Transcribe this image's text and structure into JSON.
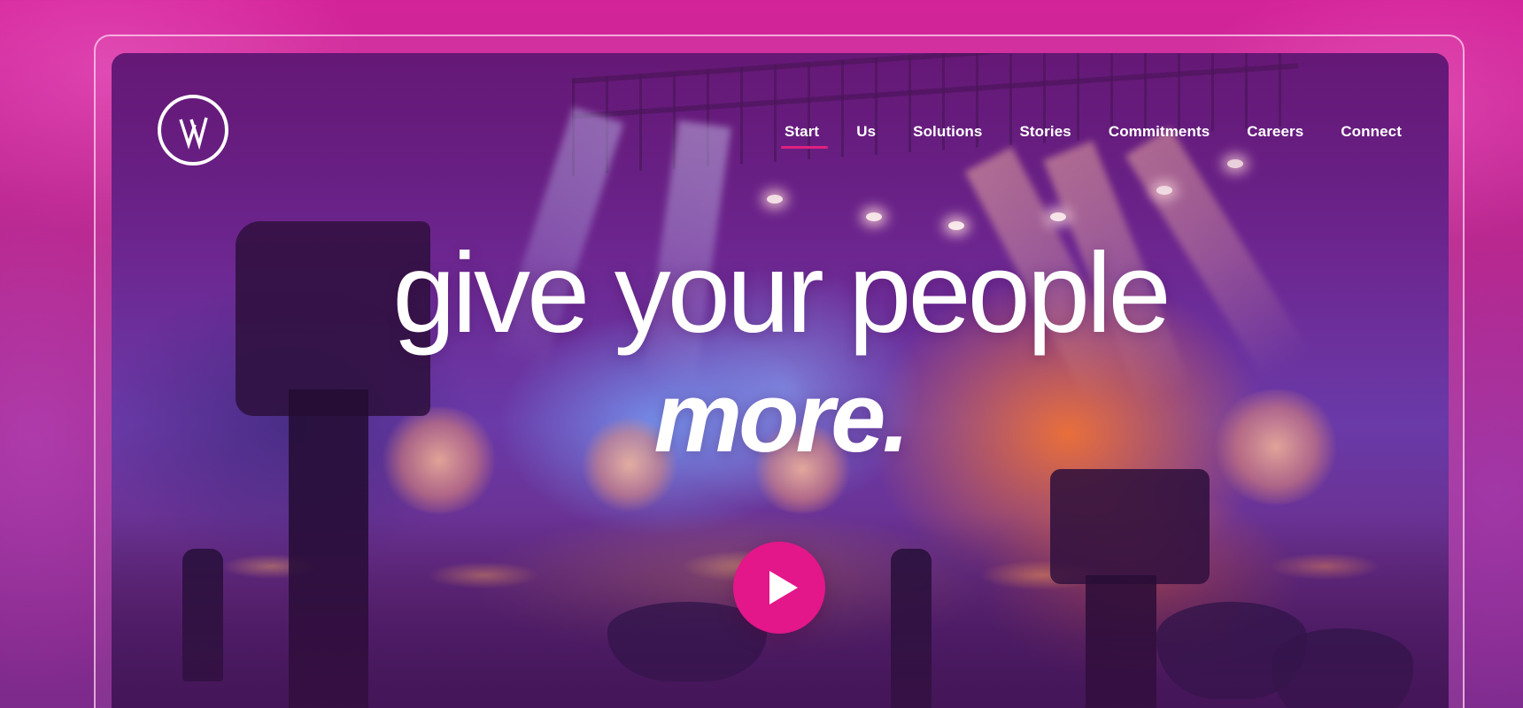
{
  "brand": {
    "logo_name": "circle-vw-logo",
    "logo_text": "W"
  },
  "nav": {
    "items": [
      {
        "label": "Start",
        "active": true
      },
      {
        "label": "Us",
        "active": false
      },
      {
        "label": "Solutions",
        "active": false
      },
      {
        "label": "Stories",
        "active": false
      },
      {
        "label": "Commitments",
        "active": false
      },
      {
        "label": "Careers",
        "active": false
      },
      {
        "label": "Connect",
        "active": false
      }
    ],
    "active_color": "#e0207e"
  },
  "hero": {
    "headline_line1": "give your people",
    "headline_line2": "more.",
    "background_image": "event-venue-stage-photo",
    "play_icon": "play-icon",
    "play_color": "#e3168a"
  },
  "colors": {
    "page_background": "#c2268f",
    "accent": "#e3168a",
    "text": "#ffffff"
  }
}
